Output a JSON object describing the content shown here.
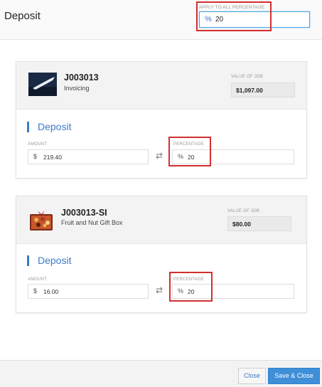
{
  "header": {
    "title": "Deposit",
    "apply_all": {
      "label": "APPLY TO ALL PERCENTAGE",
      "symbol": "%",
      "value": "20"
    }
  },
  "jobs": [
    {
      "id": "J003013",
      "name": "Invoicing",
      "value_label": "VALUE OF JOB",
      "value": "$1,097.00",
      "deposit_title": "Deposit",
      "amount_label": "AMOUNT",
      "amount_symbol": "$",
      "amount": "219.40",
      "percentage_label": "PERCENTAGE",
      "percentage_symbol": "%",
      "percentage": "20",
      "swap_icon": "swap-arrows-icon"
    },
    {
      "id": "J003013-SI",
      "name": "Fruit and Nut Gift Box",
      "value_label": "VALUE OF JOB",
      "value": "$80.00",
      "deposit_title": "Deposit",
      "amount_label": "AMOUNT",
      "amount_symbol": "$",
      "amount": "16.00",
      "percentage_label": "PERCENTAGE",
      "percentage_symbol": "%",
      "percentage": "20",
      "swap_icon": "swap-arrows-icon"
    }
  ],
  "footer": {
    "close_label": "Close",
    "save_close_label": "Save & Close"
  },
  "colors": {
    "accent": "#3a7cc9",
    "highlight": "#d32f2f",
    "primary_button": "#3e8ed8"
  }
}
